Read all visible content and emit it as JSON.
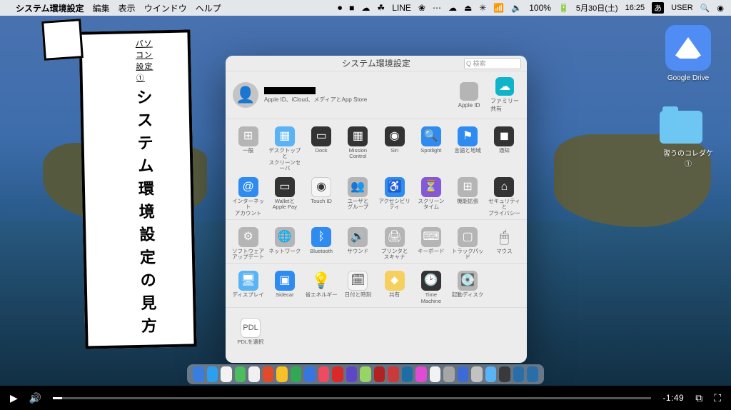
{
  "menubar": {
    "apple": "",
    "app": "システム環境設定",
    "items": [
      "編集",
      "表示",
      "ウインドウ",
      "ヘルプ"
    ],
    "status": [
      "⏺",
      "■",
      "☁",
      "☘",
      "LINE",
      "❀",
      "⋯",
      "☁",
      "⏏",
      "✳",
      "📶",
      "🔈",
      "100%",
      "🔋"
    ],
    "date": "5月30日(土)",
    "time": "16:25",
    "user": "USER",
    "ime": "あ",
    "search_icon": "🔍",
    "siri": "◉"
  },
  "desktop": {
    "gdrive": "Google Drive",
    "folder": "習うのコレダケ ①"
  },
  "title_card": {
    "apple": "",
    "sub": "パソコン設定 ①",
    "title": "システム環境設定の見方"
  },
  "pref": {
    "title": "システム環境設定",
    "search_placeholder": "検索",
    "search_glyph": "Q",
    "account_sub": "Apple ID、iCloud、メディアとApp Store",
    "right_items": [
      {
        "label": "Apple ID",
        "glyph": "",
        "cls": "bg-grey"
      },
      {
        "label": "ファミリー\n共有",
        "glyph": "☁",
        "cls": "bg-teal"
      }
    ],
    "row1": [
      {
        "label": "一般",
        "glyph": "⊞",
        "cls": "bg-grey"
      },
      {
        "label": "デスクトップと\nスクリーンセーバ",
        "glyph": "▦",
        "cls": "bg-lblue"
      },
      {
        "label": "Dock",
        "glyph": "▭",
        "cls": "bg-dark"
      },
      {
        "label": "Mission\nControl",
        "glyph": "▦",
        "cls": "bg-dark"
      },
      {
        "label": "Siri",
        "glyph": "◉",
        "cls": "bg-dark"
      },
      {
        "label": "Spotlight",
        "glyph": "🔍",
        "cls": "bg-blue"
      },
      {
        "label": "言語と地域",
        "glyph": "⚑",
        "cls": "bg-blue"
      },
      {
        "label": "通知",
        "glyph": "◼",
        "cls": "bg-dark"
      }
    ],
    "row2": [
      {
        "label": "インターネット\nアカウント",
        "glyph": "@",
        "cls": "bg-blue"
      },
      {
        "label": "Walletと\nApple Pay",
        "glyph": "▭",
        "cls": "bg-dark"
      },
      {
        "label": "Touch ID",
        "glyph": "◉",
        "cls": "bg-white"
      },
      {
        "label": "ユーザと\nグループ",
        "glyph": "👥",
        "cls": "bg-grey"
      },
      {
        "label": "アクセシビリティ",
        "glyph": "♿",
        "cls": "bg-blue"
      },
      {
        "label": "スクリーン\nタイム",
        "glyph": "⏳",
        "cls": "bg-purple"
      },
      {
        "label": "機能拡張",
        "glyph": "⊞",
        "cls": "bg-grey"
      },
      {
        "label": "セキュリティと\nプライバシー",
        "glyph": "⌂",
        "cls": "bg-dark"
      }
    ],
    "row3": [
      {
        "label": "ソフトウェア\nアップデート",
        "glyph": "⚙",
        "cls": "bg-grey"
      },
      {
        "label": "ネットワーク",
        "glyph": "🌐",
        "cls": "bg-grey"
      },
      {
        "label": "Bluetooth",
        "glyph": "ᛒ",
        "cls": "bg-blue"
      },
      {
        "label": "サウンド",
        "glyph": "🔊",
        "cls": "bg-grey"
      },
      {
        "label": "プリンタと\nスキャナ",
        "glyph": "🖨",
        "cls": "bg-grey"
      },
      {
        "label": "キーボード",
        "glyph": "⌨",
        "cls": "bg-grey"
      },
      {
        "label": "トラックパッド",
        "glyph": "▢",
        "cls": "bg-grey"
      },
      {
        "label": "マウス",
        "glyph": "🖱",
        "cls": "bg-none"
      }
    ],
    "row4": [
      {
        "label": "ディスプレイ",
        "glyph": "🖥",
        "cls": "bg-lblue"
      },
      {
        "label": "Sidecar",
        "glyph": "▣",
        "cls": "bg-blue"
      },
      {
        "label": "省エネルギー",
        "glyph": "💡",
        "cls": "bg-none"
      },
      {
        "label": "日付と時刻",
        "glyph": "🗓",
        "cls": "bg-white"
      },
      {
        "label": "共有",
        "glyph": "⬥",
        "cls": "bg-yellow"
      },
      {
        "label": "Time\nMachine",
        "glyph": "🕑",
        "cls": "bg-dark"
      },
      {
        "label": "起動ディスク",
        "glyph": "💽",
        "cls": "bg-grey"
      }
    ],
    "lower": [
      {
        "label": "PDLを選択",
        "glyph": "PDL",
        "cls": "bg-white"
      }
    ]
  },
  "dock_colors": [
    "#3a7de0",
    "#2c9fef",
    "#f2f2f2",
    "#4bbd5e",
    "#f0f0f0",
    "#e14b2a",
    "#f6c029",
    "#32a852",
    "#3776e0",
    "#ee4b60",
    "#db2828",
    "#5e47c7",
    "#98d366",
    "#b22222",
    "#c93a3a",
    "#1c6ea4",
    "#e04bd3",
    "#f2f2f2",
    "#a6a6a6",
    "#3b6bd6",
    "#c2c2c2",
    "#5ab3f4",
    "#3a3a3a",
    "#296ea8",
    "#296ea8"
  ],
  "player": {
    "play": "▶",
    "volume": "🔊",
    "time": "-1:49",
    "pip": "⧉",
    "full": "⛶"
  }
}
